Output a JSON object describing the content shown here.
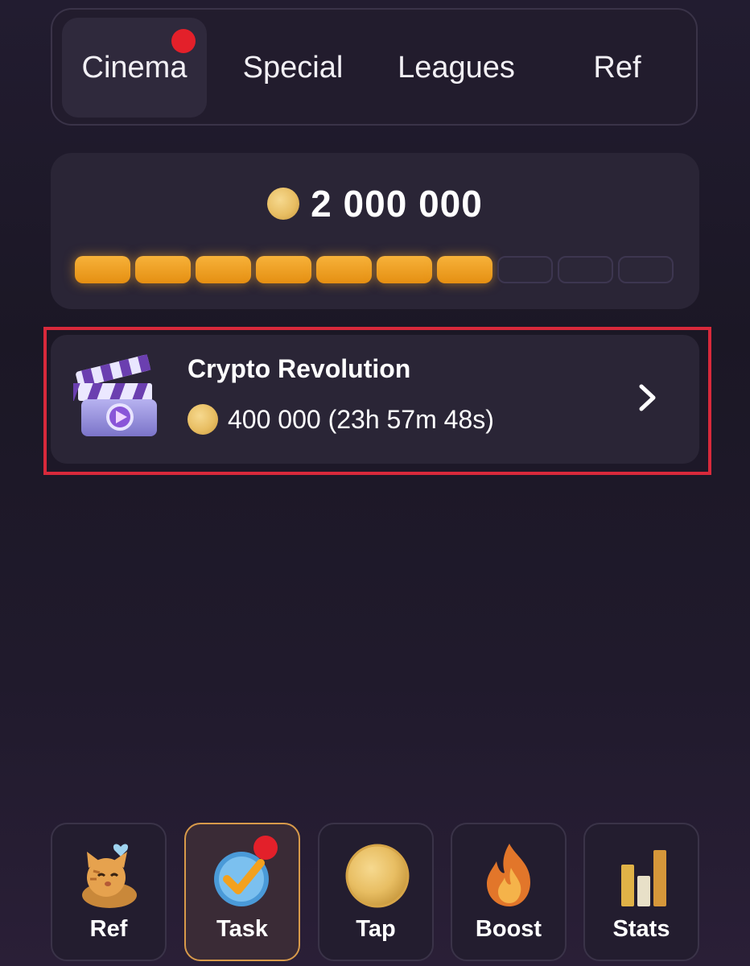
{
  "tabs": [
    {
      "label": "Cinema",
      "active": true,
      "badge": true
    },
    {
      "label": "Special",
      "active": false,
      "badge": false
    },
    {
      "label": "Leagues",
      "active": false,
      "badge": false
    },
    {
      "label": "Ref",
      "active": false,
      "badge": false
    }
  ],
  "progress": {
    "total_amount": "2 000 000",
    "segments_filled": 7,
    "segments_total": 10
  },
  "task": {
    "title": "Crypto Revolution",
    "reward": "400 000 (23h 57m 48s)",
    "icon": "clapperboard-icon"
  },
  "nav": [
    {
      "label": "Ref",
      "icon": "cat-icon",
      "active": false
    },
    {
      "label": "Task",
      "icon": "checkmark-icon",
      "active": true,
      "badge": true
    },
    {
      "label": "Tap",
      "icon": "coin-icon",
      "active": false
    },
    {
      "label": "Boost",
      "icon": "flame-icon",
      "active": false
    },
    {
      "label": "Stats",
      "icon": "bar-chart-icon",
      "active": false
    }
  ],
  "colors": {
    "accent_orange": "#f0a02a",
    "badge_red": "#e3202a",
    "highlight_red": "#d8293b"
  }
}
